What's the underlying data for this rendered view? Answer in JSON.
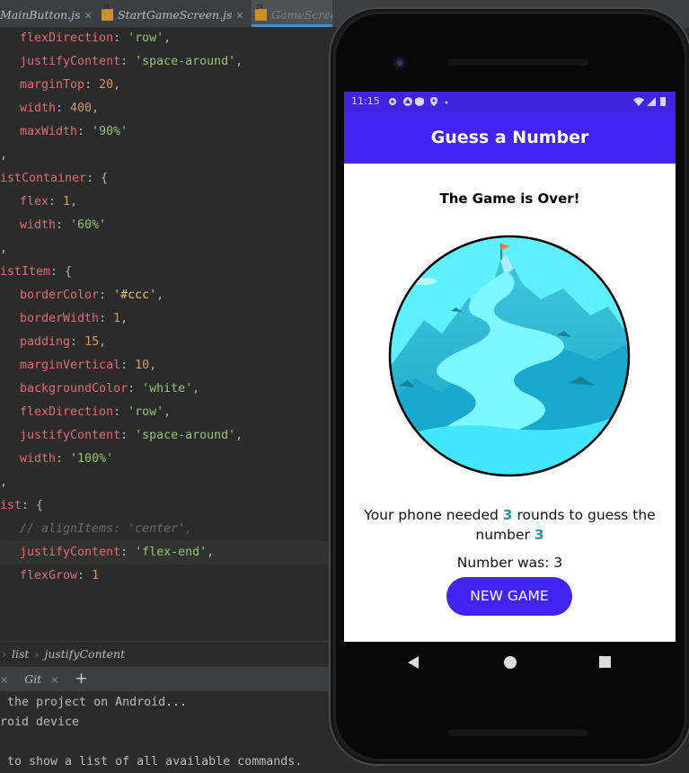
{
  "ide": {
    "tabs": [
      {
        "label": "MainButton.js",
        "active": false
      },
      {
        "label": "StartGameScreen.js",
        "active": false
      },
      {
        "label": "GameScreen",
        "active": true
      }
    ],
    "code_lines": [
      {
        "indent": 1,
        "tokens": [
          [
            "key",
            "flexDirection"
          ],
          [
            "pl",
            ": "
          ],
          [
            "str",
            "'row'"
          ],
          [
            "pl",
            ","
          ]
        ]
      },
      {
        "indent": 1,
        "tokens": [
          [
            "key",
            "justifyContent"
          ],
          [
            "pl",
            ": "
          ],
          [
            "str",
            "'space-around'"
          ],
          [
            "pl",
            ","
          ]
        ]
      },
      {
        "indent": 1,
        "tokens": [
          [
            "key",
            "marginTop"
          ],
          [
            "pl",
            ": "
          ],
          [
            "num",
            "20"
          ],
          [
            "pl",
            ","
          ]
        ]
      },
      {
        "indent": 1,
        "tokens": [
          [
            "key",
            "width"
          ],
          [
            "pl",
            ": "
          ],
          [
            "num",
            "400"
          ],
          [
            "pl",
            ","
          ]
        ]
      },
      {
        "indent": 1,
        "tokens": [
          [
            "key",
            "maxWidth"
          ],
          [
            "pl",
            ": "
          ],
          [
            "str",
            "'90%'"
          ]
        ]
      },
      {
        "indent": 0,
        "tokens": [
          [
            "pl",
            ","
          ]
        ]
      },
      {
        "indent": 0,
        "tokens": [
          [
            "key",
            "istContainer"
          ],
          [
            "pl",
            ": {"
          ]
        ]
      },
      {
        "indent": 1,
        "tokens": [
          [
            "key",
            "flex"
          ],
          [
            "pl",
            ": "
          ],
          [
            "num",
            "1"
          ],
          [
            "pl",
            ","
          ]
        ]
      },
      {
        "indent": 1,
        "tokens": [
          [
            "key",
            "width"
          ],
          [
            "pl",
            ": "
          ],
          [
            "str",
            "'60%'"
          ]
        ]
      },
      {
        "indent": 0,
        "tokens": [
          [
            "pl",
            ","
          ]
        ]
      },
      {
        "indent": 0,
        "tokens": [
          [
            "key",
            "istItem"
          ],
          [
            "pl",
            ": {"
          ]
        ]
      },
      {
        "indent": 1,
        "tokens": [
          [
            "key",
            "borderColor"
          ],
          [
            "pl",
            ": "
          ],
          [
            "strhi",
            "'#ccc'"
          ],
          [
            "pl",
            ","
          ]
        ]
      },
      {
        "indent": 1,
        "tokens": [
          [
            "key",
            "borderWidth"
          ],
          [
            "pl",
            ": "
          ],
          [
            "num",
            "1"
          ],
          [
            "pl",
            ","
          ]
        ]
      },
      {
        "indent": 1,
        "tokens": [
          [
            "key",
            "padding"
          ],
          [
            "pl",
            ": "
          ],
          [
            "num",
            "15"
          ],
          [
            "pl",
            ","
          ]
        ]
      },
      {
        "indent": 1,
        "tokens": [
          [
            "key",
            "marginVertical"
          ],
          [
            "pl",
            ": "
          ],
          [
            "num",
            "10"
          ],
          [
            "pl",
            ","
          ]
        ]
      },
      {
        "indent": 1,
        "tokens": [
          [
            "key",
            "backgroundColor"
          ],
          [
            "pl",
            ": "
          ],
          [
            "str",
            "'white'"
          ],
          [
            "pl",
            ","
          ]
        ]
      },
      {
        "indent": 1,
        "tokens": [
          [
            "key",
            "flexDirection"
          ],
          [
            "pl",
            ": "
          ],
          [
            "str",
            "'row'"
          ],
          [
            "pl",
            ","
          ]
        ]
      },
      {
        "indent": 1,
        "tokens": [
          [
            "key",
            "justifyContent"
          ],
          [
            "pl",
            ": "
          ],
          [
            "str",
            "'space-around'"
          ],
          [
            "pl",
            ","
          ]
        ]
      },
      {
        "indent": 1,
        "tokens": [
          [
            "key",
            "width"
          ],
          [
            "pl",
            ": "
          ],
          [
            "str",
            "'100%'"
          ]
        ]
      },
      {
        "indent": 0,
        "tokens": [
          [
            "pl",
            ","
          ]
        ]
      },
      {
        "indent": 0,
        "tokens": [
          [
            "key",
            "ist"
          ],
          [
            "pl",
            ": {"
          ]
        ]
      },
      {
        "indent": 1,
        "tokens": [
          [
            "cm",
            "// alignItems: 'center',"
          ]
        ]
      },
      {
        "indent": 1,
        "highlight": true,
        "tokens": [
          [
            "key",
            "justifyContent"
          ],
          [
            "pl",
            ": "
          ],
          [
            "str",
            "'flex-end'"
          ],
          [
            "pl",
            ","
          ]
        ]
      },
      {
        "indent": 1,
        "tokens": [
          [
            "key",
            "flexGrow"
          ],
          [
            "pl",
            ": "
          ],
          [
            "num",
            "1"
          ]
        ]
      }
    ],
    "breadcrumb": [
      "list",
      "justifyContent"
    ],
    "terminal_tabs": {
      "git": "Git",
      "plus": "+"
    },
    "terminal_lines": [
      " the project on Android...",
      "roid device",
      "",
      " to show a list of all available commands."
    ]
  },
  "phone": {
    "status_time": "11:15",
    "app_title": "Guess a Number",
    "heading": "The Game is Over!",
    "result": {
      "prefix": "Your phone needed ",
      "rounds": "3",
      "middle": " rounds to guess the number ",
      "number": "3"
    },
    "number_was": "Number was: 3",
    "button_label": "NEW GAME",
    "colors": {
      "primary": "#4124f0",
      "accent": "#2f8fa5"
    },
    "nav_icons": [
      "back-icon",
      "home-icon",
      "recents-icon"
    ]
  }
}
